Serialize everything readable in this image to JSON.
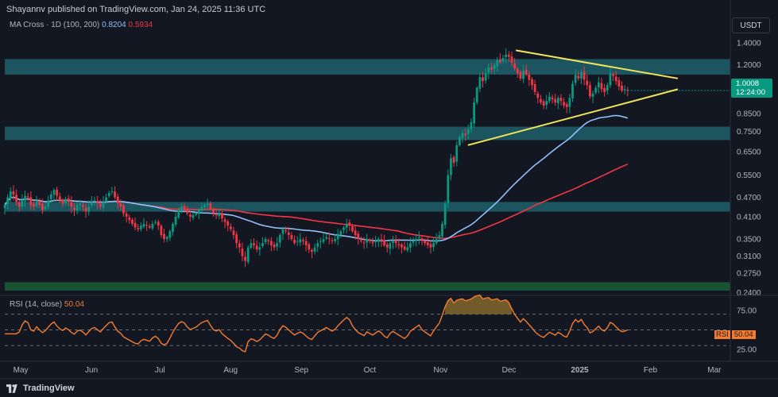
{
  "header": {
    "publisher_line": "Shayannv published on TradingView.com, Jan 24, 2025 11:36 UTC"
  },
  "indicator_legend": {
    "label": "MA Cross · 1D (100, 200)",
    "ma_fast_value": "0.8204",
    "ma_slow_value": "0.5934"
  },
  "quote_currency": "USDT",
  "last_price": {
    "value": "1.0008",
    "countdown": "12:24:00"
  },
  "rsi_legend": {
    "label": "RSI (14, close)",
    "value": "50.04"
  },
  "rsi_badge": {
    "tag": "RSI",
    "value": "50.04"
  },
  "footer": {
    "brand": "TradingView"
  },
  "colors": {
    "background": "#131722",
    "zone_fill": "#1e5f6b",
    "support_zone_fill": "#1b5e36",
    "ma_fast": "#90bff9",
    "ma_slow": "#f23645",
    "triangle": "#f2e45a",
    "candle_up": "#089981",
    "candle_down": "#f23645",
    "rsi_line": "#f57c2e",
    "rsi_fill": "#8a6d2e"
  },
  "chart_data": [
    {
      "type": "candlestick",
      "ylim": [
        0.235,
        1.45
      ],
      "scale": "log",
      "grid": false,
      "y_ticks": [
        "1.4000",
        "1.2000",
        "0.8500",
        "0.7500",
        "0.6500",
        "0.5500",
        "0.4700",
        "0.4100",
        "0.3500",
        "0.3100",
        "0.2750",
        "0.2400"
      ],
      "x_ticks": [
        "May",
        "Jun",
        "Jul",
        "Aug",
        "Sep",
        "Oct",
        "Nov",
        "Dec",
        "2025",
        "Feb",
        "Mar"
      ],
      "x_start": "2024-04-24",
      "zones": [
        {
          "name": "",
          "low": 1.12,
          "high": 1.25
        },
        {
          "name": "",
          "low": 0.705,
          "high": 0.775
        },
        {
          "name": "",
          "low": 0.425,
          "high": 0.455
        },
        {
          "name": "",
          "low": 0.243,
          "high": 0.258
        }
      ],
      "triangle": {
        "upper": [
          [
            "2024-12-04",
            1.33
          ],
          [
            "2025-02-13",
            1.09
          ]
        ],
        "lower": [
          [
            "2024-11-13",
            0.68
          ],
          [
            "2025-02-13",
            1.01
          ]
        ]
      },
      "closes": [
        0.445,
        0.47,
        0.49,
        0.48,
        0.455,
        0.44,
        0.46,
        0.475,
        0.47,
        0.445,
        0.44,
        0.46,
        0.445,
        0.43,
        0.44,
        0.46,
        0.48,
        0.495,
        0.475,
        0.46,
        0.45,
        0.465,
        0.455,
        0.44,
        0.43,
        0.445,
        0.45,
        0.44,
        0.425,
        0.44,
        0.455,
        0.46,
        0.45,
        0.44,
        0.455,
        0.47,
        0.485,
        0.49,
        0.47,
        0.45,
        0.44,
        0.42,
        0.41,
        0.4,
        0.39,
        0.38,
        0.375,
        0.385,
        0.39,
        0.385,
        0.38,
        0.39,
        0.395,
        0.385,
        0.36,
        0.35,
        0.355,
        0.37,
        0.39,
        0.41,
        0.43,
        0.44,
        0.435,
        0.42,
        0.41,
        0.415,
        0.42,
        0.43,
        0.44,
        0.445,
        0.45,
        0.435,
        0.42,
        0.415,
        0.42,
        0.405,
        0.395,
        0.385,
        0.375,
        0.36,
        0.34,
        0.33,
        0.31,
        0.3,
        0.33,
        0.34,
        0.335,
        0.325,
        0.33,
        0.34,
        0.35,
        0.345,
        0.335,
        0.33,
        0.34,
        0.36,
        0.375,
        0.37,
        0.36,
        0.35,
        0.34,
        0.345,
        0.35,
        0.345,
        0.335,
        0.325,
        0.32,
        0.33,
        0.34,
        0.345,
        0.35,
        0.355,
        0.35,
        0.345,
        0.35,
        0.36,
        0.37,
        0.38,
        0.39,
        0.385,
        0.37,
        0.36,
        0.35,
        0.345,
        0.34,
        0.35,
        0.345,
        0.34,
        0.345,
        0.35,
        0.345,
        0.335,
        0.33,
        0.34,
        0.345,
        0.34,
        0.335,
        0.33,
        0.325,
        0.33,
        0.34,
        0.345,
        0.35,
        0.355,
        0.345,
        0.34,
        0.335,
        0.33,
        0.34,
        0.35,
        0.36,
        0.39,
        0.45,
        0.55,
        0.62,
        0.6,
        0.68,
        0.72,
        0.74,
        0.73,
        0.76,
        0.8,
        0.92,
        1.02,
        1.1,
        1.07,
        1.13,
        1.18,
        1.16,
        1.2,
        1.24,
        1.22,
        1.26,
        1.29,
        1.27,
        1.22,
        1.17,
        1.13,
        1.09,
        1.15,
        1.12,
        1.08,
        1.04,
        0.99,
        0.95,
        0.92,
        0.9,
        0.93,
        0.96,
        0.94,
        0.92,
        0.95,
        0.93,
        0.9,
        0.89,
        0.95,
        1.05,
        1.12,
        1.09,
        1.14,
        1.08,
        1.04,
        0.96,
        0.98,
        1.02,
        1.06,
        1.01,
        0.99,
        1.04,
        1.13,
        1.11,
        1.07,
        1.03,
        1.0,
        1.01,
        1.0
      ],
      "ma_fast": {
        "name": "",
        "value_at_end": 0.8204
      },
      "ma_slow": {
        "name": "",
        "value_at_end": 0.5934
      },
      "last": 1.0008
    },
    {
      "type": "line",
      "name": "",
      "ylim": [
        10,
        90
      ],
      "y_ticks": [
        "75.00",
        "25.00"
      ],
      "levels": [
        70,
        50,
        30
      ],
      "last": 50.04
    }
  ]
}
